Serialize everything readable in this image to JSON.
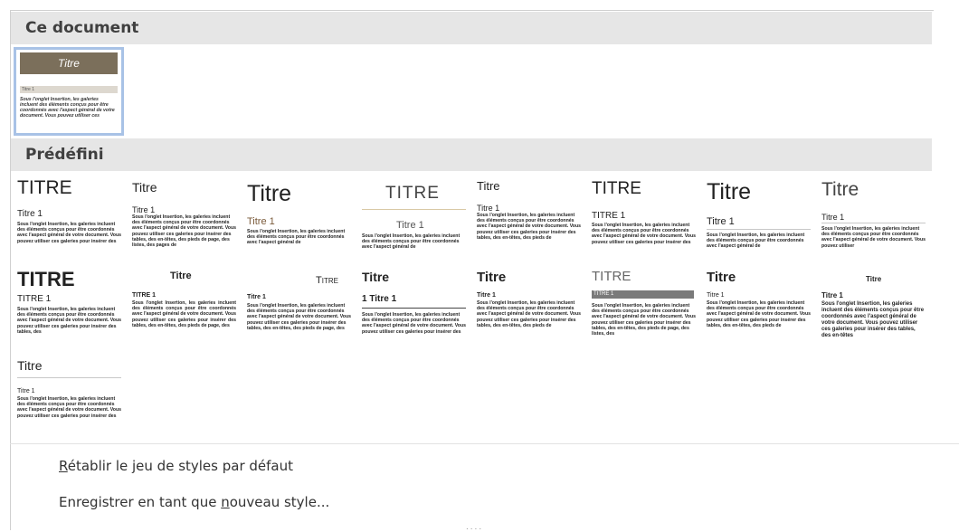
{
  "sections": {
    "current": "Ce document",
    "predefined": "Prédéfini"
  },
  "current_style": {
    "title": "Titre",
    "heading": "Titre 1",
    "body": "Sous l'onglet Insertion, les galeries incluent des éléments conçus pour être coordonnés avec l'aspect général de votre document. Vous pouvez utiliser ces"
  },
  "thumbnails": [
    {
      "title": "TITRE",
      "heading": "Titre 1",
      "body": "Sous l'onglet Insertion, les galeries incluent des éléments conçus pour être coordonnés avec l'aspect général de votre document. Vous pouvez utiliser ces galeries pour insérer des"
    },
    {
      "title": "Titre",
      "heading": "Titre 1",
      "body": "Sous l'onglet Insertion, les galeries incluent des éléments conçus pour être coordonnés avec l'aspect général de votre document. Vous pouvez utiliser ces galeries pour insérer des tables, des en-têtes, des pieds de page, des listes, des pages de"
    },
    {
      "title": "Titre",
      "heading": "Titre 1",
      "body": "Sous l'onglet Insertion, les galeries incluent des éléments conçus pour être coordonnés avec l'aspect général de"
    },
    {
      "title": "TITRE",
      "heading": "Titre 1",
      "body": "Sous l'onglet Insertion, les galeries incluent des éléments conçus pour être coordonnés avec l'aspect général de"
    },
    {
      "title": "Titre",
      "heading": "Titre 1",
      "body": "Sous l'onglet Insertion, les galeries incluent des éléments conçus pour être coordonnés avec l'aspect général de votre document. Vous pouvez utiliser ces galeries pour insérer des tables, des en-têtes, des pieds de"
    },
    {
      "title": "TITRE",
      "heading": "TITRE 1",
      "body": "Sous l'onglet Insertion, les galeries incluent des éléments conçus pour être coordonnés avec l'aspect général de votre document. Vous pouvez utiliser ces galeries pour insérer des"
    },
    {
      "title": "Titre",
      "heading": "Titre 1",
      "body": "Sous l'onglet Insertion, les galeries incluent des éléments conçus pour être coordonnés avec l'aspect général de"
    },
    {
      "title": "Titre",
      "heading": "Titre 1",
      "body": "Sous l'onglet Insertion, les galeries incluent des éléments conçus pour être coordonnés avec l'aspect général de votre document. Vous pouvez utiliser"
    },
    {
      "title": "TITRE",
      "heading": "TITRE 1",
      "body": "Sous l'onglet Insertion, les galeries incluent des éléments conçus pour être coordonnés avec l'aspect général de votre document. Vous pouvez utiliser ces galeries pour insérer des tables, des"
    },
    {
      "title": "Titre",
      "heading": "TITRE 1",
      "body": "Sous l'onglet Insertion, les galeries incluent des éléments conçus pour être coordonnés avec l'aspect général de votre document. Vous pouvez utiliser ces galeries pour insérer des tables, des en-têtes, des pieds de page, des"
    },
    {
      "title": "Titre",
      "heading": "Titre 1",
      "body": "Sous l'onglet Insertion, les galeries incluent des éléments conçus pour être coordonnés avec l'aspect général de votre document. Vous pouvez utiliser ces galeries pour insérer des tables, des en-têtes, des pieds de page, des"
    },
    {
      "title": "Titre",
      "heading": "1   Titre 1",
      "body": "Sous l'onglet Insertion, les galeries incluent des éléments conçus pour être coordonnés avec l'aspect général de votre document. Vous pouvez utiliser ces galeries pour insérer des"
    },
    {
      "title": "Titre",
      "heading": "Titre 1",
      "body": "Sous l'onglet Insertion, les galeries incluent des éléments conçus pour être coordonnés avec l'aspect général de votre document. Vous pouvez utiliser ces galeries pour insérer des tables, des en-têtes, des pieds de"
    },
    {
      "title": "TITRE",
      "heading": "TITRE 1",
      "body": "Sous l'onglet Insertion, les galeries incluent des éléments conçus pour être coordonnés avec l'aspect général de votre document. Vous pouvez utiliser ces galeries pour insérer des tables, des en-têtes, des pieds de page, des listes, des"
    },
    {
      "title": "Titre",
      "heading": "Titre 1",
      "body": "Sous l'onglet Insertion, les galeries incluent des éléments conçus pour être coordonnés avec l'aspect général de votre document. Vous pouvez utiliser ces galeries pour insérer des tables, des en-têtes, des pieds de"
    },
    {
      "title": "Titre",
      "heading": "Titre 1",
      "body": "Sous l'onglet Insertion, les galeries incluent des éléments conçus pour être coordonnés avec l'aspect général de votre document. Vous pouvez utiliser ces galeries pour insérer des tables, des en-têtes"
    },
    {
      "title": "Titre",
      "heading": "Titre 1",
      "body": "Sous l'onglet Insertion, les galeries incluent des éléments conçus pour être coordonnés avec l'aspect général de votre document. Vous pouvez utiliser ces galeries pour insérer des"
    }
  ],
  "menu": {
    "reset": {
      "accel": "R",
      "rest": "établir le jeu de styles par défaut"
    },
    "save": {
      "pre": "Enregistrer en tant que ",
      "accel": "n",
      "rest": "ouveau style..."
    }
  },
  "grip": "....",
  "colors": {
    "header_bg": "#e6e6e6",
    "selection": "#a8c2e6",
    "accent_band": "#7b6f5b"
  }
}
